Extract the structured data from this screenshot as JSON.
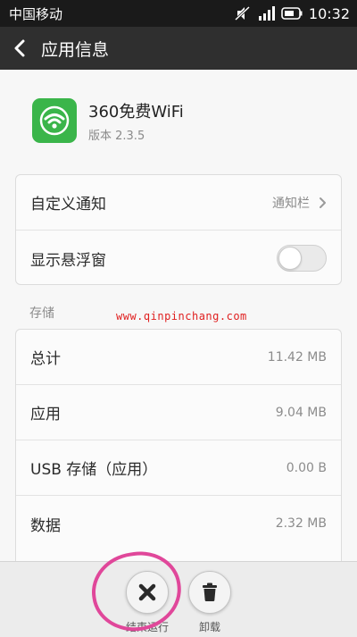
{
  "status_bar": {
    "carrier": "中国移动",
    "time": "10:32",
    "icons": [
      "mute-icon",
      "signal-icon",
      "battery-icon"
    ]
  },
  "title_bar": {
    "back_icon": "chevron-left-icon",
    "title": "应用信息"
  },
  "app": {
    "icon": "wifi-icon",
    "icon_color": "#3ab54a",
    "name": "360免费WiFi",
    "version": "版本 2.3.5"
  },
  "notifications": {
    "custom_notify_label": "自定义通知",
    "custom_notify_value": "通知栏",
    "floating_window_label": "显示悬浮窗",
    "floating_window_enabled": false
  },
  "storage": {
    "section_label": "存储",
    "rows": [
      {
        "label": "总计",
        "value": "11.42 MB"
      },
      {
        "label": "应用",
        "value": "9.04 MB"
      },
      {
        "label": "USB 存储（应用）",
        "value": "0.00 B"
      },
      {
        "label": "数据",
        "value": "2.32 MB"
      }
    ]
  },
  "watermark": "www.qinpinchang.com",
  "actions": {
    "force_stop_label": "结束运行",
    "uninstall_label": "卸载"
  },
  "colors": {
    "annotation": "#e0479a",
    "watermark": "#e02020"
  }
}
